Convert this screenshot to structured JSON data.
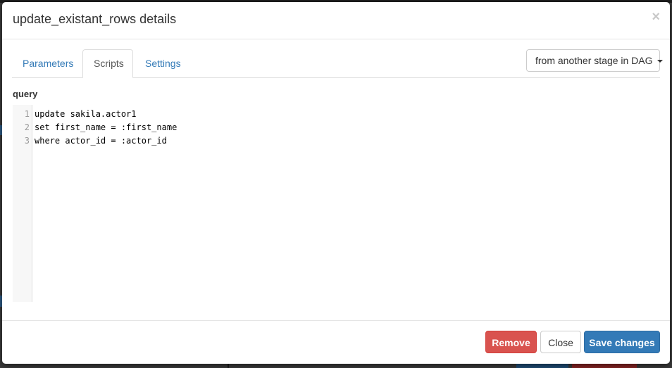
{
  "modal": {
    "title": "update_existant_rows details",
    "close_symbol": "×"
  },
  "tabs": [
    {
      "label": "Parameters",
      "active": false
    },
    {
      "label": "Scripts",
      "active": true
    },
    {
      "label": "Settings",
      "active": false
    }
  ],
  "source_dropdown": {
    "selected": "from another stage in DAG"
  },
  "query": {
    "label": "query",
    "lines": [
      {
        "number": "1",
        "text": "update sakila.actor1"
      },
      {
        "number": "2",
        "text": "set first_name = :first_name"
      },
      {
        "number": "3",
        "text": "where actor_id = :actor_id"
      }
    ]
  },
  "footer": {
    "remove_label": "Remove",
    "close_label": "Close",
    "save_label": "Save changes"
  },
  "colors": {
    "primary": "#337ab7",
    "danger": "#d9534f",
    "link": "#337ab7"
  },
  "icons": {
    "close": "close-icon",
    "dropdown": "caret-down-icon"
  }
}
